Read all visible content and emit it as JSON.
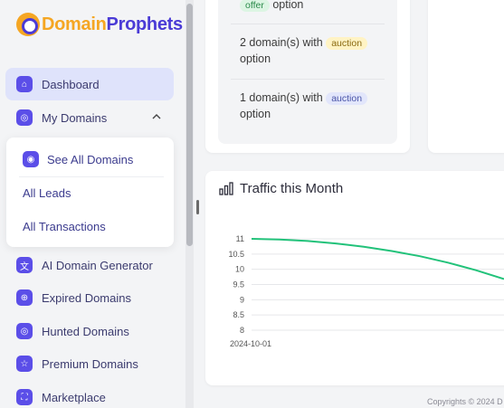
{
  "brand": {
    "part1": "Domain",
    "part2": "Prophets"
  },
  "sidebar": {
    "dashboard": "Dashboard",
    "my_domains": "My Domains",
    "submenu": {
      "see_all": "See All Domains",
      "leads": "All Leads",
      "transactions": "All Transactions"
    },
    "ai_generator": "AI Domain Generator",
    "expired": "Expired Domains",
    "hunted": "Hunted Domains",
    "premium": "Premium Domains",
    "marketplace": "Marketplace"
  },
  "summary": {
    "row1": {
      "badge": "offer",
      "suffix": "option"
    },
    "row2": {
      "prefix": "2 domain(s) with",
      "badge": "auction",
      "suffix": "option"
    },
    "row3": {
      "prefix": "1 domain(s) with",
      "badge": "auction",
      "suffix": "option"
    }
  },
  "traffic": {
    "title": "Traffic this Month"
  },
  "chart_data": {
    "type": "line",
    "x": [
      "2024-10-01"
    ],
    "series": [
      {
        "values": [
          11,
          10.98,
          10.93,
          10.85,
          10.74,
          10.6,
          10.43,
          10.22,
          9.97,
          9.68
        ]
      }
    ],
    "yticks": [
      "11",
      "10.5",
      "10",
      "9.5",
      "9",
      "8.5",
      "8"
    ],
    "ylim": [
      8,
      11
    ],
    "grid": true,
    "line_color": "#22c27a"
  },
  "footer": {
    "text": "Copyrights © 2024 D"
  }
}
